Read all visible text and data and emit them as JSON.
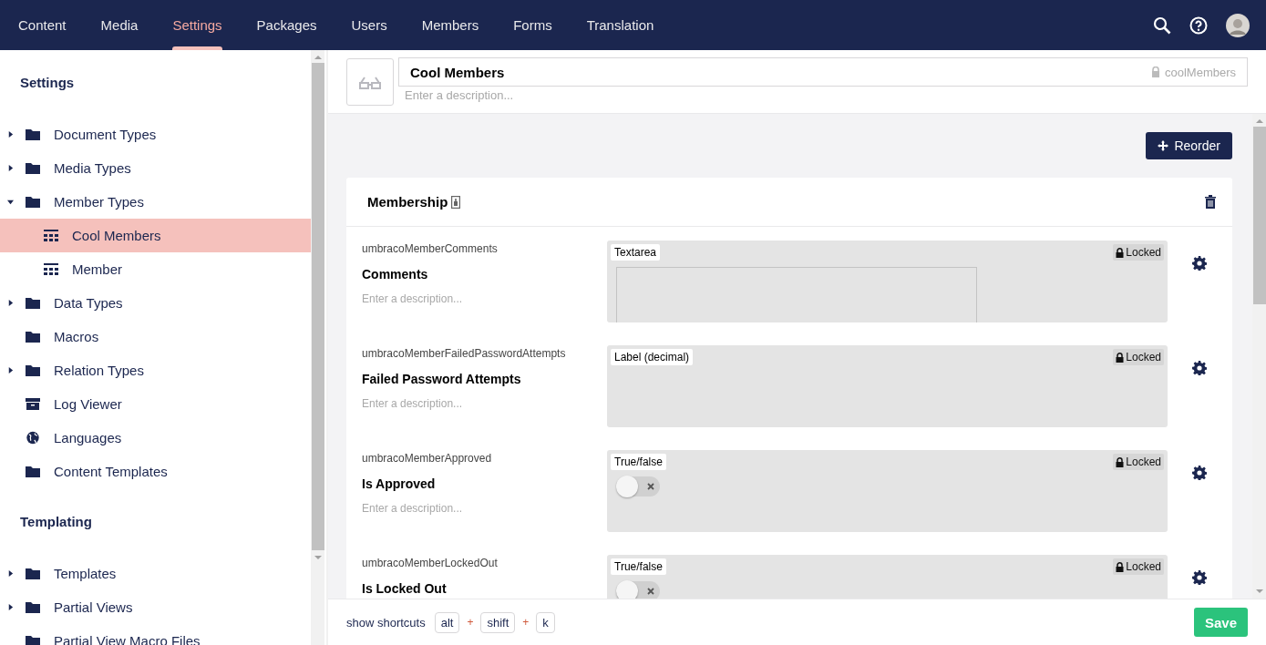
{
  "nav": {
    "tabs": [
      {
        "label": "Content",
        "selected": false
      },
      {
        "label": "Media",
        "selected": false
      },
      {
        "label": "Settings",
        "selected": true
      },
      {
        "label": "Packages",
        "selected": false
      },
      {
        "label": "Users",
        "selected": false
      },
      {
        "label": "Members",
        "selected": false
      },
      {
        "label": "Forms",
        "selected": false
      },
      {
        "label": "Translation",
        "selected": false
      }
    ]
  },
  "sidebar": {
    "sections": [
      {
        "title": "Settings",
        "items": [
          {
            "label": "Document Types",
            "kind": "folder",
            "expandable": true,
            "expanded": false,
            "selected": false
          },
          {
            "label": "Media Types",
            "kind": "folder",
            "expandable": true,
            "expanded": false,
            "selected": false
          },
          {
            "label": "Member Types",
            "kind": "folder",
            "expandable": true,
            "expanded": true,
            "selected": false,
            "children": [
              {
                "label": "Cool Members",
                "kind": "grid",
                "expandable": false,
                "selected": true
              },
              {
                "label": "Member",
                "kind": "grid",
                "expandable": false,
                "selected": false
              }
            ]
          },
          {
            "label": "Data Types",
            "kind": "folder",
            "expandable": true,
            "expanded": false,
            "selected": false
          },
          {
            "label": "Macros",
            "kind": "folder",
            "expandable": false,
            "selected": false
          },
          {
            "label": "Relation Types",
            "kind": "folder",
            "expandable": true,
            "expanded": false,
            "selected": false
          },
          {
            "label": "Log Viewer",
            "kind": "archive",
            "expandable": false,
            "selected": false
          },
          {
            "label": "Languages",
            "kind": "globe",
            "expandable": false,
            "selected": false
          },
          {
            "label": "Content Templates",
            "kind": "folder",
            "expandable": false,
            "selected": false
          }
        ]
      },
      {
        "title": "Templating",
        "items": [
          {
            "label": "Templates",
            "kind": "folder",
            "expandable": true,
            "expanded": false,
            "selected": false
          },
          {
            "label": "Partial Views",
            "kind": "folder",
            "expandable": true,
            "expanded": false,
            "selected": false
          },
          {
            "label": "Partial View Macro Files",
            "kind": "folder",
            "expandable": false,
            "selected": false
          }
        ]
      }
    ]
  },
  "editor": {
    "name": "Cool Members",
    "alias": "coolMembers",
    "alias_locked": true,
    "description_placeholder": "Enter a description...",
    "reorder_button": "Reorder",
    "group": {
      "title": "Membership",
      "properties": [
        {
          "alias": "umbracoMemberComments",
          "label": "Comments",
          "description_placeholder": "Enter a description...",
          "editor": "Textarea",
          "kind": "textarea",
          "locked": true,
          "locked_label": "Locked"
        },
        {
          "alias": "umbracoMemberFailedPasswordAttempts",
          "label": "Failed Password Attempts",
          "description_placeholder": "Enter a description...",
          "editor": "Label (decimal)",
          "kind": "label",
          "locked": true,
          "locked_label": "Locked"
        },
        {
          "alias": "umbracoMemberApproved",
          "label": "Is Approved",
          "description_placeholder": "Enter a description...",
          "editor": "True/false",
          "kind": "toggle",
          "checked": false,
          "locked": true,
          "locked_label": "Locked"
        },
        {
          "alias": "umbracoMemberLockedOut",
          "label": "Is Locked Out",
          "editor": "True/false",
          "kind": "toggle",
          "checked": false,
          "locked": true,
          "locked_label": "Locked"
        }
      ]
    }
  },
  "footer": {
    "shortcuts_link": "show shortcuts",
    "shortcut_parts": [
      {
        "kind": "key",
        "text": "alt"
      },
      {
        "kind": "plus",
        "text": "+"
      },
      {
        "kind": "key",
        "text": "shift"
      },
      {
        "kind": "plus",
        "text": "+"
      },
      {
        "kind": "key",
        "text": "k"
      }
    ],
    "save_button": "Save"
  }
}
